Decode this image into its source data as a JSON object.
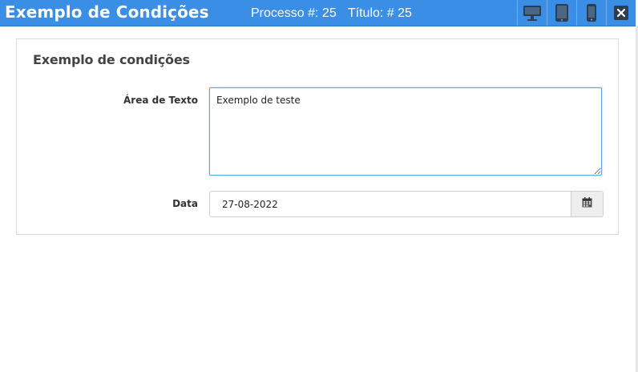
{
  "window": {
    "title": "Exemplo de Condições",
    "process_text": "Processo #: 25",
    "title_text": "Título: # 25",
    "buttons": [
      {
        "icon": "desktop-icon"
      },
      {
        "icon": "tablet-icon"
      },
      {
        "icon": "mobile-icon"
      },
      {
        "icon": "close-icon"
      }
    ],
    "colors": {
      "titlebar": "#3a8ee6",
      "focus_border": "#5aa7e6"
    }
  },
  "form": {
    "title": "Exemplo de condições",
    "text_area": {
      "label": "Área de Texto",
      "value": "Exemplo de teste"
    },
    "date": {
      "label": "Data",
      "value": "27-08-2022",
      "button_icon": "calendar-icon"
    }
  }
}
